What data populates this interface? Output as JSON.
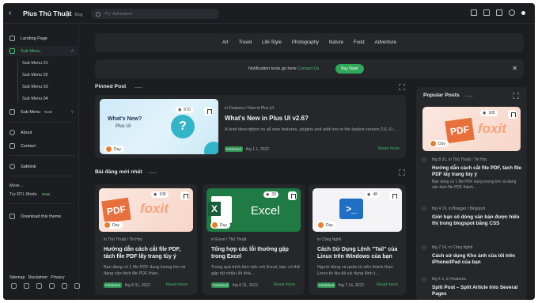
{
  "header": {
    "title": "Plus Thủ Thuật",
    "subtitle": "Blog",
    "search_placeholder": "Try 'Adventure'"
  },
  "sidebar": {
    "landing": "Landing Page",
    "submenu": "Sub Menu",
    "subitems": [
      "Sub Menu 01",
      "Sub Menu 02",
      "Sub Menu 03",
      "Sub Menu 04"
    ],
    "submenu2": "Sub Menu",
    "submenu2_badge": "New!",
    "about": "About",
    "contact": "Contact",
    "safelink": "Safelink",
    "more": "More...",
    "rtl": "Try RTL Mode",
    "rtl_badge": "New!",
    "download": "Download this theme",
    "footer_links": [
      "Sitemap",
      "Disclaimer",
      "Privacy"
    ]
  },
  "categories": [
    "Art",
    "Travel",
    "Life Style",
    "Photography",
    "Nature",
    "Food",
    "Adventure"
  ],
  "notification": {
    "text": "Notification texts go here",
    "link": "Contact Us",
    "button": "Buy Now!"
  },
  "pinned": {
    "section": "Pinned Post",
    "meta": "in Features / New in Plus UI",
    "title": "What's New in Plus UI v2.6?",
    "desc": "A brief description on all new features, plugins and add-ons in the lastest version 2.6. Fi...",
    "badge": "Published",
    "date": "thg 1 1, 2022",
    "more": "Read more",
    "views": "570",
    "author": "Duy",
    "thumb_title": "What's New?",
    "thumb_sub": "Plus UI",
    "thumb_icon": "?"
  },
  "latest": {
    "section": "Bài đăng mới nhất",
    "posts": [
      {
        "meta": "in Thủ Thuật / Tin Học",
        "title": "Hướng dẫn cách cắt file PDF, tách file PDF lấy trang tùy ý",
        "desc": "Bạn đang có 1 file PDF dung lượng lớn và đang cần tách file PDF thàn...",
        "badge": "Published",
        "date": "thg 8 31, 2022",
        "more": "Read more",
        "views": "105",
        "author": "Duy",
        "thumb_text": "PDF",
        "thumb_brand": "foxit"
      },
      {
        "meta": "in Excel / Thủ Thuật",
        "title": "Tổng hợp các lỗi thường gặp trong Excel",
        "desc": "Trong quá trình làm việc với Excel, bạn có thể gặp rất nhiều lỗi khá...",
        "badge": "Published",
        "date": "thg 8 31, 2022",
        "more": "Read more",
        "views": "29",
        "author": "Duy",
        "thumb_text": "Excel"
      },
      {
        "meta": "in Công Nghệ",
        "title": "Cách Sử Dụng Lệnh \"Tail\" của Linux trên Windows của bạn",
        "desc": "Người dùng và quản trị viên thành thạo Linux từ lâu đã sử dụng lệnh t...",
        "badge": "Published",
        "date": "thg 7 14, 2022",
        "more": "Read more",
        "views": "48",
        "author": "Duy"
      }
    ]
  },
  "popular": {
    "section": "Popular Posts",
    "top": {
      "views": "105",
      "author": "Duy",
      "thumb_text": "PDF",
      "thumb_brand": "foxit"
    },
    "items": [
      {
        "meta": "thg 8 31, in Thủ Thuật / Tin Học",
        "title": "Hướng dẫn cách cắt file PDF, tách file PDF lấy trang tùy ý",
        "desc": "Bạn đang có 1 file PDF dung lượng lớn và đang cần tách file PDF thành..."
      },
      {
        "meta": "thg 4 19, in Blogger / Blogspot",
        "title": "Giới hạn số dòng văn bản được hiển thị trong blogspot bằng CSS"
      },
      {
        "meta": "thg 7 14, in Công Nghệ",
        "title": "Cách sử dụng Kho ảnh của tôi trên iPhone/iPad của bạn"
      },
      {
        "meta": "thg 1 1, in Features",
        "title": "Split Post – Split Article Into Several Pages"
      }
    ]
  }
}
